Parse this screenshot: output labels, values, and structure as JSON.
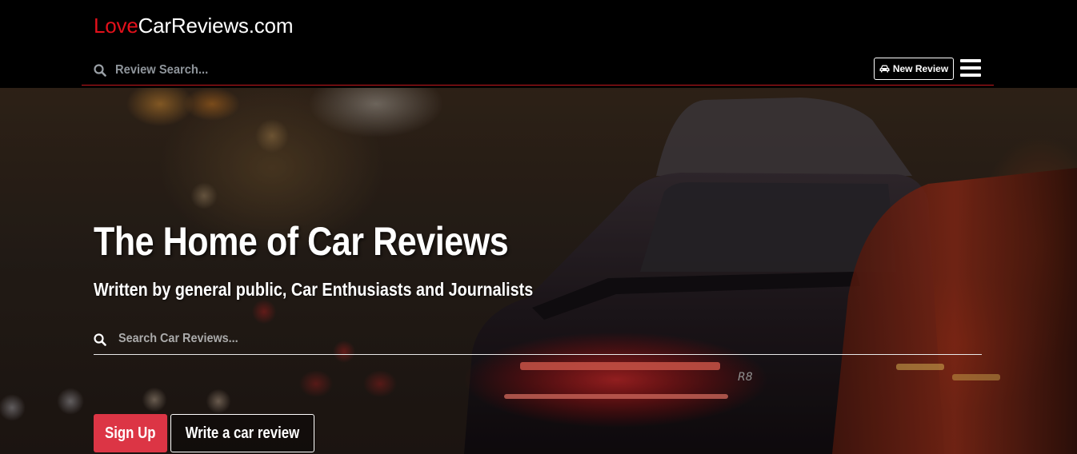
{
  "header": {
    "logo_accent": "Love",
    "logo_rest": "CarReviews.com",
    "search_placeholder": "Review Search...",
    "new_review_label": "New Review"
  },
  "hero": {
    "title": "The Home of Car Reviews",
    "subtitle": "Written by general public, Car Enthusiasts and Journalists",
    "search_placeholder": "Search Car Reviews...",
    "signup_label": "Sign Up",
    "write_review_label": "Write a car review"
  },
  "icons": {
    "search": "search-icon",
    "new_review": "car-icon",
    "menu": "hamburger-menu-icon"
  },
  "colors": {
    "brand_red": "#e3111b",
    "signup_red": "#dc3545",
    "header_bg": "#000000"
  }
}
